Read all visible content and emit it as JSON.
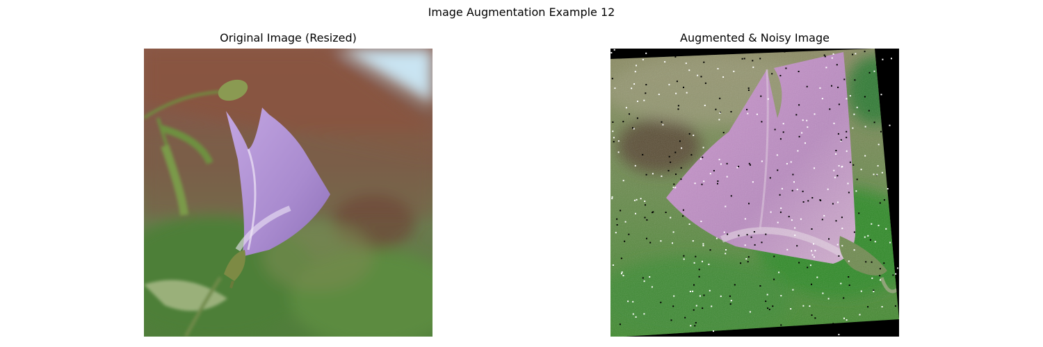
{
  "figure": {
    "title": "Image Augmentation Example 12"
  },
  "panels": [
    {
      "title": "Original Image (Resized)"
    },
    {
      "title": "Augmented & Noisy Image"
    }
  ],
  "colors": {
    "petal": "#b89ad6",
    "petal_aug": "#c08cc8",
    "foliage": "#5e8a3e",
    "foliage_aug": "#3f8a2e",
    "brick": "#7a5546",
    "sky": "#c9e4f2",
    "pad": "#000000"
  }
}
